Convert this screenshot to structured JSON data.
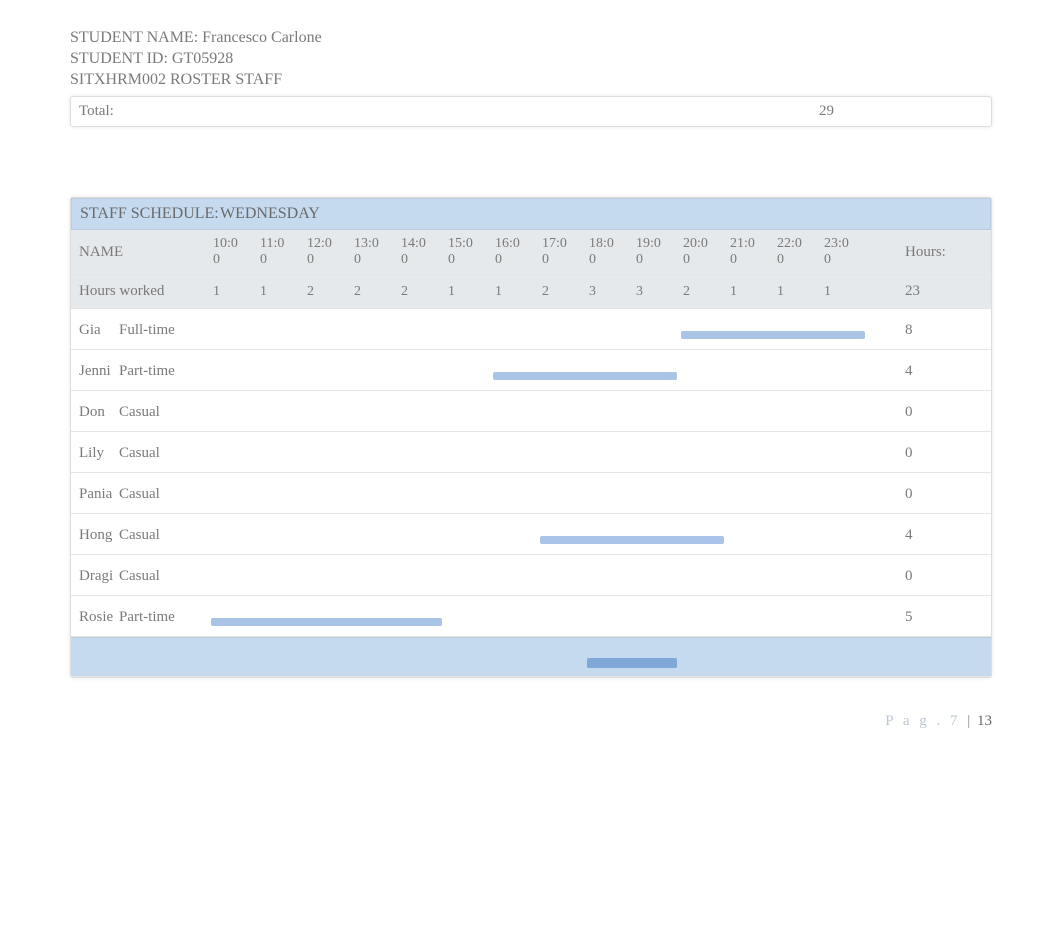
{
  "student_name_label": "STUDENT NAME:",
  "student_name": "Francesco Carlone",
  "student_id_label": "STUDENT ID:",
  "student_id": "GT05928",
  "course_line": "SITXHRM002 ROSTER STAFF",
  "top_total_label": "Total:",
  "top_total_value": "29",
  "schedule_title_left": "STAFF SCHEDULE:",
  "schedule_title_right": "WEDNESDAY",
  "name_header": "NAME",
  "hours_header": "Hours:",
  "time_headers": [
    "10:00",
    "11:00",
    "12:00",
    "13:00",
    "14:00",
    "15:00",
    "16:00",
    "17:00",
    "18:00",
    "19:00",
    "20:00",
    "21:00",
    "22:00",
    "23:00"
  ],
  "hours_worked_label": "Hours worked",
  "hours_worked_values": [
    "1",
    "1",
    "2",
    "2",
    "2",
    "1",
    "1",
    "2",
    "3",
    "3",
    "2",
    "1",
    "1",
    "1"
  ],
  "hours_worked_total": "23",
  "staff": [
    {
      "first": "Gia",
      "role": "Full-time",
      "hours": "8",
      "bar_start": 10,
      "bar_span": 4
    },
    {
      "first": "Jenni",
      "role": "Part-time",
      "hours": "4",
      "bar_start": 6,
      "bar_span": 4
    },
    {
      "first": "Don",
      "role": "Casual",
      "hours": "0",
      "bar_start": -1,
      "bar_span": 0
    },
    {
      "first": "Lily",
      "role": "Casual",
      "hours": "0",
      "bar_start": -1,
      "bar_span": 0
    },
    {
      "first": "Pania",
      "role": "Casual",
      "hours": "0",
      "bar_start": -1,
      "bar_span": 0
    },
    {
      "first": "Hong",
      "role": "Casual",
      "hours": "4",
      "bar_start": 7,
      "bar_span": 4
    },
    {
      "first": "Dragi",
      "role": "Casual",
      "hours": "0",
      "bar_start": -1,
      "bar_span": 0
    },
    {
      "first": "Rosie",
      "role": "Part-time",
      "hours": "5",
      "bar_start": 0,
      "bar_span": 5
    }
  ],
  "bottom_chip_start": 8,
  "bottom_chip_span": 2,
  "footer_page_label": "P a g . 7",
  "footer_sep": "|",
  "footer_total_pages": "13",
  "chart_data": {
    "type": "table",
    "title": "Staff Schedule Wednesday",
    "columns": [
      "10:00",
      "11:00",
      "12:00",
      "13:00",
      "14:00",
      "15:00",
      "16:00",
      "17:00",
      "18:00",
      "19:00",
      "20:00",
      "21:00",
      "22:00",
      "23:00",
      "Hours"
    ],
    "rows": [
      {
        "name": "Hours worked",
        "values": [
          1,
          1,
          2,
          2,
          2,
          1,
          1,
          2,
          3,
          3,
          2,
          1,
          1,
          1,
          23
        ]
      },
      {
        "name": "Gia Full-time",
        "values": [
          0,
          0,
          0,
          0,
          0,
          0,
          0,
          0,
          0,
          0,
          1,
          1,
          1,
          1,
          8
        ]
      },
      {
        "name": "Jenni Part-time",
        "values": [
          0,
          0,
          0,
          0,
          0,
          0,
          1,
          1,
          1,
          1,
          0,
          0,
          0,
          0,
          4
        ]
      },
      {
        "name": "Don Casual",
        "values": [
          0,
          0,
          0,
          0,
          0,
          0,
          0,
          0,
          0,
          0,
          0,
          0,
          0,
          0,
          0
        ]
      },
      {
        "name": "Lily Casual",
        "values": [
          0,
          0,
          0,
          0,
          0,
          0,
          0,
          0,
          0,
          0,
          0,
          0,
          0,
          0,
          0
        ]
      },
      {
        "name": "Pania Casual",
        "values": [
          0,
          0,
          0,
          0,
          0,
          0,
          0,
          0,
          0,
          0,
          0,
          0,
          0,
          0,
          0
        ]
      },
      {
        "name": "Hong Casual",
        "values": [
          0,
          0,
          0,
          0,
          0,
          0,
          0,
          1,
          1,
          1,
          1,
          0,
          0,
          0,
          4
        ]
      },
      {
        "name": "Dragi Casual",
        "values": [
          0,
          0,
          0,
          0,
          0,
          0,
          0,
          0,
          0,
          0,
          0,
          0,
          0,
          0,
          0
        ]
      },
      {
        "name": "Rosie Part-time",
        "values": [
          1,
          1,
          1,
          1,
          1,
          0,
          0,
          0,
          0,
          0,
          0,
          0,
          0,
          0,
          5
        ]
      }
    ]
  }
}
